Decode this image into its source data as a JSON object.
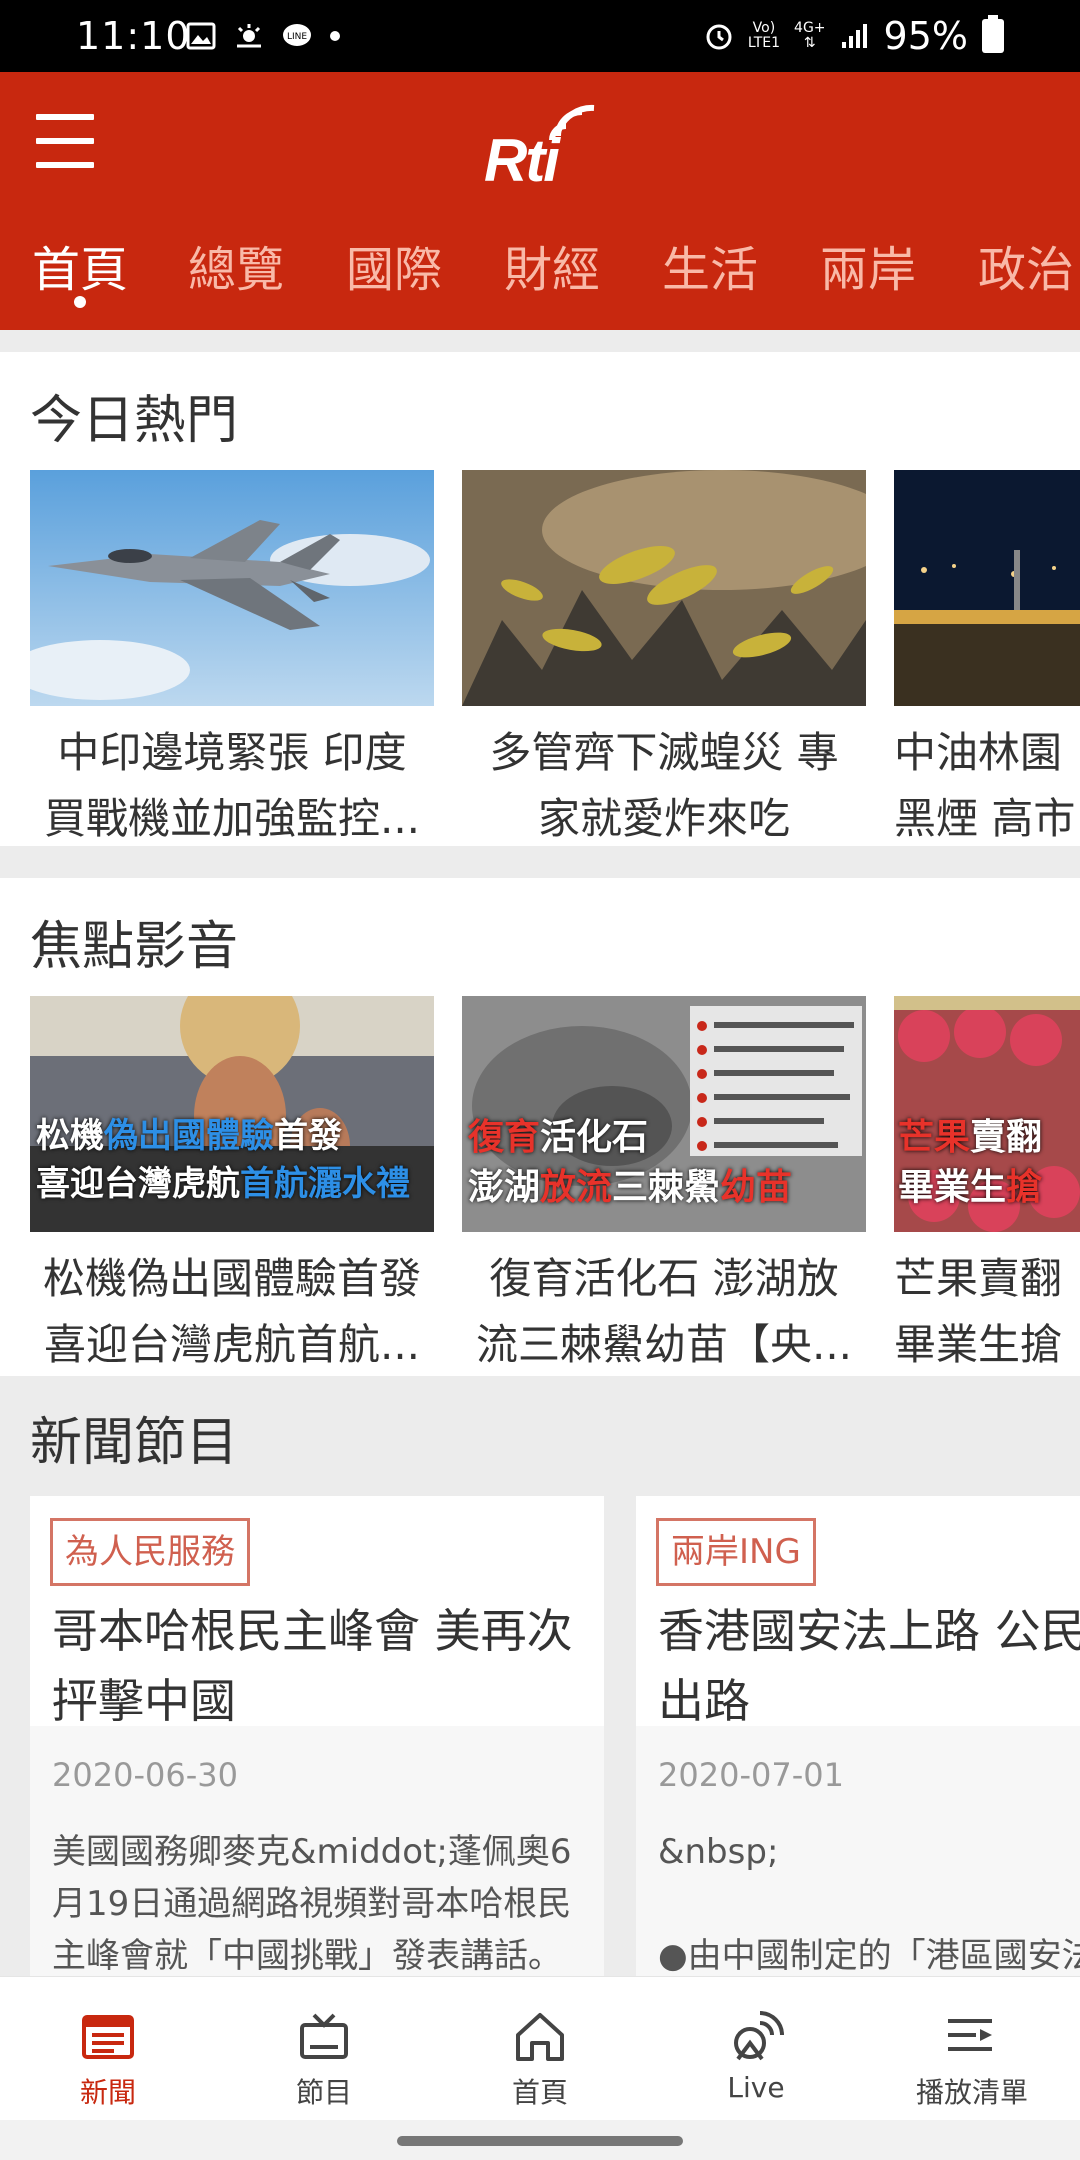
{
  "status_bar": {
    "time": "11:10",
    "network_top": "Vo)",
    "network_bottom": "LTE1",
    "data_top": "4G+",
    "battery": "95%"
  },
  "header": {
    "logo": "Rti",
    "tabs": [
      "首頁",
      "總覽",
      "國際",
      "財經",
      "生活",
      "兩岸",
      "政治"
    ],
    "active_tab": "首頁"
  },
  "hot_today": {
    "title": "今日熱門",
    "cards": [
      {
        "line1": "中印邊境緊張 印度",
        "line2": "買戰機並加強監控..."
      },
      {
        "line1": "多管齊下滅蝗災 專",
        "line2": "家就愛炸來吃"
      },
      {
        "line1": "中油林園",
        "line2": "黑煙  高市"
      }
    ]
  },
  "focus_video": {
    "title": "焦點影音",
    "cards": [
      {
        "line1": "松機偽出國體驗首發",
        "line2": "喜迎台灣虎航首航...",
        "thumb_line1_a": "松機",
        "thumb_line1_b": "偽出國體驗",
        "thumb_line1_c": "首發",
        "thumb_line2_a": "喜迎台灣虎航",
        "thumb_line2_b": "首航灑水禮"
      },
      {
        "line1": "復育活化石 澎湖放",
        "line2": "流三棘鱟幼苗【央...",
        "thumb_line1_a": "復育",
        "thumb_line1_b": "活化石",
        "thumb_line2_a": "澎湖",
        "thumb_line2_b": "放流",
        "thumb_line2_c": "三棘鱟",
        "thumb_line2_d": "幼苗"
      },
      {
        "line1": "芒果賣翻",
        "line2": "畢業生搶",
        "thumb_line1_a": "芒果",
        "thumb_line1_b": "賣翻",
        "thumb_line2_a": "畢業生",
        "thumb_line2_b": "搶"
      }
    ]
  },
  "news_programs": {
    "title": "新聞節目",
    "cards": [
      {
        "tag": "為人民服務",
        "headline": "哥本哈根民主峰會 美再次抨擊中國",
        "date": "2020-06-30",
        "desc": "美國國務卿麥克&middot;蓬佩奧6月19日通過網路視頻對哥本哈根民主峰會就「中國挑戰」發表講話。"
      },
      {
        "tag": "兩岸ING",
        "headline": "香港國安法上路 公民另找出路",
        "date": "2020-07-01",
        "desc_line1": "&nbsp;",
        "desc_line2": "●由中國制定的「港區國安法"
      }
    ]
  },
  "bottom_nav": [
    {
      "label": "新聞",
      "icon": "newspaper-icon",
      "active": true
    },
    {
      "label": "節目",
      "icon": "tv-icon",
      "active": false
    },
    {
      "label": "首頁",
      "icon": "home-icon",
      "active": false
    },
    {
      "label": "Live",
      "icon": "broadcast-icon",
      "active": false
    },
    {
      "label": "播放清單",
      "icon": "playlist-icon",
      "active": false
    }
  ],
  "colors": {
    "brand": "#c8280f",
    "tag": "#d0604f"
  }
}
